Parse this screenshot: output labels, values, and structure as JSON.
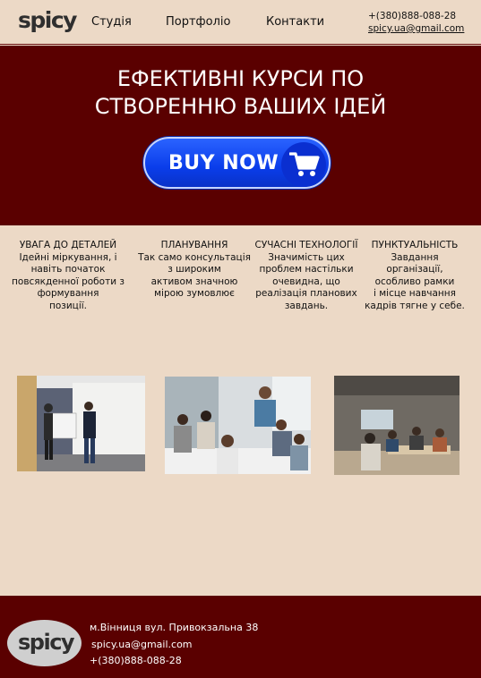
{
  "header": {
    "logo": "spicy",
    "nav": [
      "Студія",
      "Портфоліо",
      "Контакти"
    ],
    "phone": "+(380)888-088-28",
    "email": "spicy.ua@gmail.com"
  },
  "hero": {
    "title_line1": "ЕФЕКТИВНІ КУРСИ ПО",
    "title_line2": "СТВОРЕННЮ ВАШИХ ІДЕЙ",
    "button_label": "BUY NOW",
    "button_icon": "shopping-cart-icon"
  },
  "features": [
    {
      "title": "УВАГА ДО ДЕТАЛЕЙ",
      "lines": [
        "Ідейні міркування, і",
        "навіть початок",
        "повсякденної роботи з",
        "формування",
        "позиції."
      ]
    },
    {
      "title": "ПЛАНУВАННЯ",
      "lines": [
        "Так само консультація",
        "з широким",
        "активом значною",
        "мірою зумовлює"
      ]
    },
    {
      "title": "СУЧАСНІ ТЕХНОЛОГІЇ",
      "lines": [
        "Значимість цих",
        "проблем настільки",
        "очевидна, що",
        "реалізація планових",
        "завдань."
      ]
    },
    {
      "title": "ПУНКТУАЛЬНІСТЬ",
      "lines": [
        "Завдання організації,",
        "особливо рамки",
        "і місце навчання",
        "кадрів тягне у себе."
      ]
    }
  ],
  "photos": [
    "presentation-photo",
    "team-meeting-photo",
    "classroom-photo"
  ],
  "footer": {
    "logo": "spicy",
    "address": "м.Вінниця вул. Привокзальна 38",
    "email": "spicy.ua@gmail.com",
    "phone": "+(380)888-088-28"
  },
  "colors": {
    "background": "#ecd9c6",
    "brand_dark_red": "#5a0000",
    "button_blue": "#0a3dea"
  }
}
